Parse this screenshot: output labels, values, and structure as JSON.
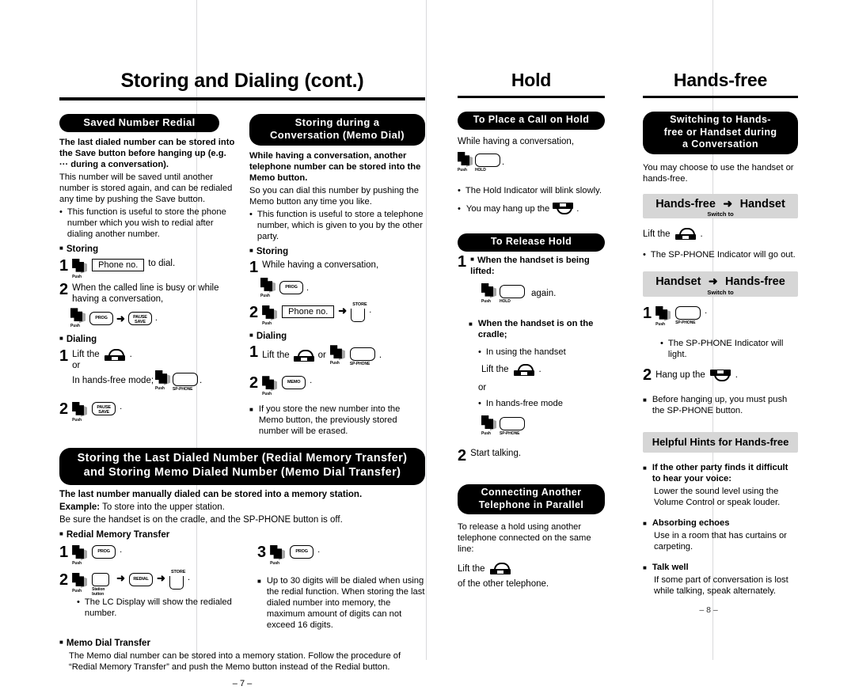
{
  "document": {
    "type": "scanned-manual-page",
    "folds": [
      248,
      538,
      900
    ]
  },
  "col1": {
    "header": "Storing and Dialing (cont.)",
    "block_a": {
      "title": "Saved Number Redial",
      "p1": "The last dialed number can be stored into the Save button before hanging up (e.g. ··· during a conversation).",
      "p2": "This number will be saved until another number is stored again, and can be redialed any time by pushing the Save button.",
      "bullet1": "This function is useful to store the phone number which you wish to redial after dialing another number.",
      "storing_label": "Storing",
      "step1_num": "1",
      "step1_push": "Push",
      "step1_field": "Phone no.",
      "step1_tail": "to dial.",
      "step2_num": "2",
      "step2_text": "When the called line is busy or while having a conversation,",
      "step2_push": "Push",
      "step2_btn1": "PROG",
      "step2_arrow": "➜",
      "step2_btn2": "PAUSE\nSAVE",
      "step2_btn2_l1": "PAUSE",
      "step2_btn2_l2": "SAVE",
      "step2_period": ".",
      "dialing_label": "Dialing",
      "d1_num": "1",
      "d1_text": "Lift the",
      "d1_period": ".",
      "d1_or": "or",
      "d1_line2": "In hands-free mode;",
      "d1_push": "Push",
      "d1_btn_label": "SP-PHONE",
      "d1_tail": ".",
      "d2_num": "2",
      "d2_push": "Push",
      "d2_btn_l1": "PAUSE",
      "d2_btn_l2": "SAVE",
      "d2_period": "."
    },
    "block_b": {
      "title": "Storing during a Conversation (Memo Dial)",
      "title_l1": "Storing during a",
      "title_l2": "Conversation (Memo Dial)",
      "p1": "While having a conversation, another telephone number can be stored into the Memo button.",
      "p2": "So you can dial this number by pushing the Memo button any time you like.",
      "bullet1": "This function is useful to store a telephone number, which is given to you by the other party.",
      "storing_label": "Storing",
      "s1_num": "1",
      "s1_text": "While having a conversation,",
      "s1_push": "Push",
      "s1_btn": "PROG",
      "s1_period": ".",
      "s2_num": "2",
      "s2_push": "Push",
      "s2_field": "Phone no.",
      "s2_arrow": "➜",
      "s2_btn_cap": "STORE",
      "s2_period": ".",
      "dialing_label": "Dialing",
      "d1_num": "1",
      "d1_text": "Lift the",
      "d1_or": "or",
      "d1_push": "Push",
      "d1_btn_label": "SP-PHONE",
      "d1_period": ".",
      "d2_num": "2",
      "d2_push": "Push",
      "d2_btn": "MEMO",
      "d2_period": ".",
      "note": "If you store the new number into the Memo button, the previously stored number will be erased."
    },
    "banner": {
      "line1": "Storing the Last Dialed Number (Redial Memory Transfer)",
      "line2": "and Storing Memo Dialed Number (Memo Dial Transfer)"
    },
    "wide": {
      "p1": "The last number manually dialed can be stored into a memory station.",
      "p2_label": "Example:",
      "p2_rest": " To store into the upper station.",
      "p3": "Be sure the handset is on the cradle, and the SP-PHONE button is off.",
      "sub1": "Redial Memory Transfer",
      "r1_num": "1",
      "r1_push": "Push",
      "r1_btn": "PROG",
      "r1_period": ".",
      "r2_num": "2",
      "r2_push": "Push",
      "r2_sub_l1": "Station",
      "r2_sub_l2": "button",
      "r2_arrow1": "➜",
      "r2_btn2": "REDIAL",
      "r2_arrow2": "➜",
      "r2_cap": "STORE",
      "r2_period": ".",
      "r2_bullet": "The LC Display will show the redialed number.",
      "r3_num": "3",
      "r3_push": "Push",
      "r3_btn": "PROG",
      "r3_period": ".",
      "right_note": "Up to 30 digits will be dialed when using the redial function. When storing the last dialed number into memory, the maximum amount of digits can not exceed 16 digits.",
      "sub2": "Memo Dial Transfer",
      "sub2_body": "The Memo dial number can be stored into a memory station. Follow the procedure of “Redial Memory Transfer” and push the Memo button instead of the Redial button."
    },
    "page_number": "– 7 –"
  },
  "col3": {
    "header": "Hold",
    "block_a": {
      "title": "To Place a Call on Hold",
      "p1": "While having a conversation,",
      "push": "Push",
      "btn_label": "HOLD",
      "period": ".",
      "bullet1": "The Hold Indicator will blink slowly.",
      "bullet2_pre": "You may hang up the",
      "bullet2_post": "."
    },
    "block_b": {
      "title": "To Release Hold",
      "s1_num": "1",
      "s1_head": "When the handset is being lifted:",
      "s1_push": "Push",
      "s1_btn_label": "HOLD",
      "s1_tail": "again.",
      "s1_head2": "When the handset is on the cradle;",
      "s1_b1": "In using the handset",
      "s1_lift": "Lift the",
      "s1_lift_period": ".",
      "s1_or": "or",
      "s1_b2": "In hands-free mode",
      "s1_push2": "Push",
      "s1_btn2_label": "SP-PHONE",
      "s2_num": "2",
      "s2_text": "Start talking."
    },
    "block_c": {
      "title_l1": "Connecting Another",
      "title_l2": "Telephone in Parallel",
      "p1": "To release a hold using another telephone connected on the same line:",
      "p2_pre": "Lift the",
      "p2_post": "of the other telephone."
    },
    "page_number": "– 8 –"
  },
  "col4": {
    "header": "Hands-free",
    "block_a": {
      "title_l1": "Switching to Hands-",
      "title_l2": "free or Handset during",
      "title_l3": "a Conversation",
      "p1": "You may choose to use the handset or hands-free.",
      "bar1_left": "Hands-free",
      "bar1_arrow": "➜",
      "bar1_right": "Handset",
      "bar1_sub": "Switch to",
      "lift_pre": "Lift the",
      "lift_post": ".",
      "bullet1": "The SP-PHONE Indicator will go out.",
      "bar2_left": "Handset",
      "bar2_arrow": "➜",
      "bar2_right": "Hands-free",
      "bar2_sub": "Switch to",
      "s1_num": "1",
      "s1_push": "Push",
      "s1_btn_label": "SP-PHONE",
      "s1_period": ".",
      "s1_bullet": "The SP-PHONE Indicator will light.",
      "s2_num": "2",
      "s2_pre": "Hang up the",
      "s2_post": ".",
      "note": "Before hanging up, you must push the SP-PHONE button."
    },
    "block_b": {
      "title": "Helpful Hints for Hands-free",
      "h1": "If the other party finds it difficult to hear your voice:",
      "b1": "Lower the sound level using the Volume Control or speak louder.",
      "h2": "Absorbing echoes",
      "b2": "Use in a room that has curtains or carpeting.",
      "h3": "Talk well",
      "b3": "If some part of conversation is lost while talking, speak alternately."
    }
  }
}
